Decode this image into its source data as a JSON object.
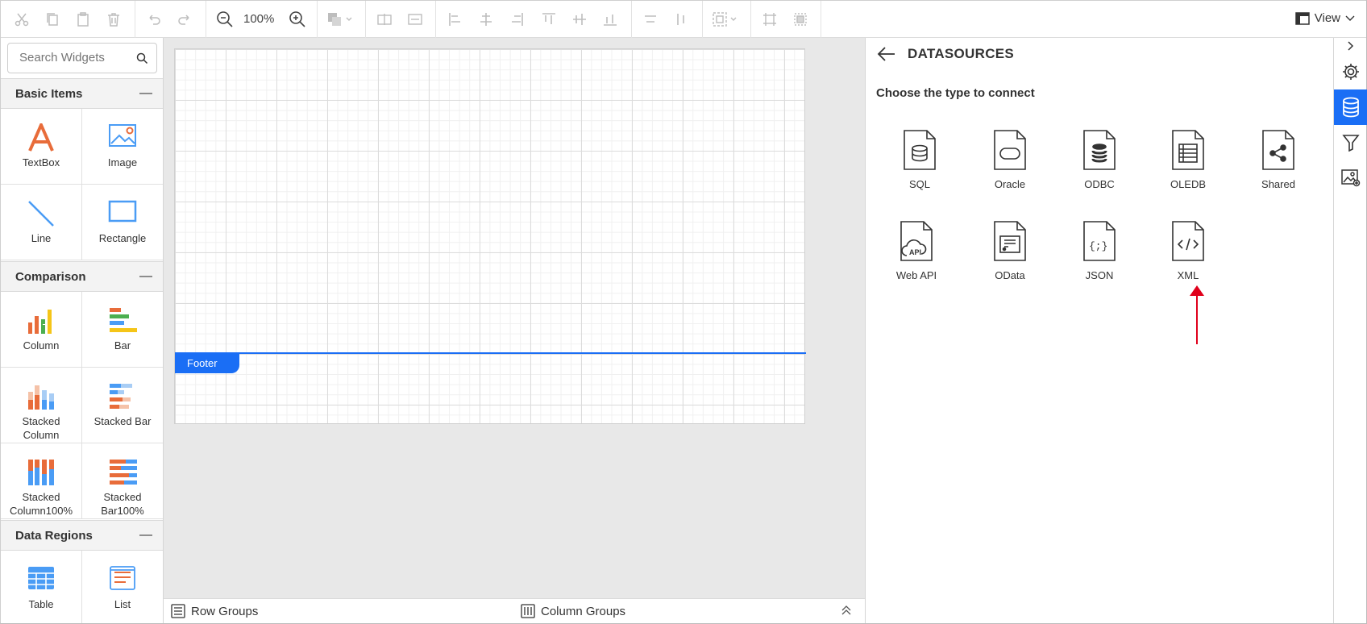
{
  "toolbar": {
    "zoom": "100%",
    "view_label": "View"
  },
  "search": {
    "placeholder": "Search Widgets"
  },
  "sections": {
    "basic": {
      "title": "Basic Items",
      "items": [
        "TextBox",
        "Image",
        "Line",
        "Rectangle"
      ]
    },
    "comparison": {
      "title": "Comparison",
      "items": [
        "Column",
        "Bar",
        "Stacked",
        "Column",
        "Stacked Bar",
        "Stacked",
        "Column100%",
        "Stacked",
        "Bar100%"
      ]
    },
    "data_regions": {
      "title": "Data Regions",
      "items": [
        "Table",
        "List"
      ]
    }
  },
  "collapse_symbol": "—",
  "design": {
    "footer_label": "Footer"
  },
  "bottom": {
    "row_groups": "Row Groups",
    "column_groups": "Column Groups"
  },
  "datasources": {
    "title": "DATASOURCES",
    "subtitle": "Choose the type to connect",
    "types": [
      "SQL",
      "Oracle",
      "ODBC",
      "OLEDB",
      "Shared",
      "Web API",
      "OData",
      "JSON",
      "XML"
    ]
  },
  "colors": {
    "accent": "#1a6ef5",
    "arrow": "#e0001b",
    "orange": "#e86c3a",
    "blue": "#4a9cf5",
    "yellow": "#f5c518",
    "green": "#4caf50"
  }
}
